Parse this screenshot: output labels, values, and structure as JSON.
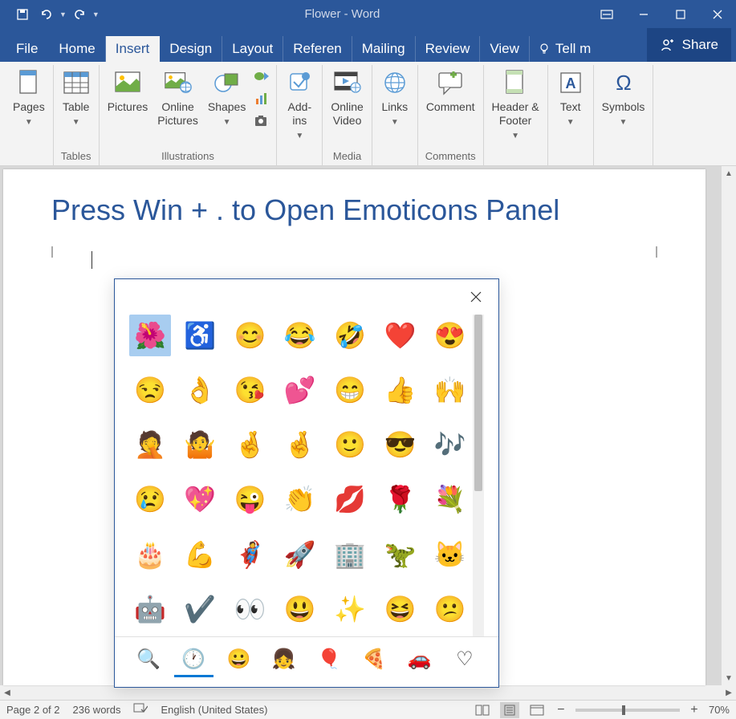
{
  "title": "Flower - Word",
  "menubar": {
    "file": "File",
    "items": [
      "Home",
      "Insert",
      "Design",
      "Layout",
      "Referen",
      "Mailing",
      "Review",
      "View"
    ],
    "active": "Insert",
    "tellme": "Tell m",
    "share": "Share"
  },
  "ribbon": {
    "groups": [
      {
        "label": "",
        "buttons": [
          {
            "label": "Pages",
            "dd": true
          }
        ]
      },
      {
        "label": "Tables",
        "buttons": [
          {
            "label": "Table",
            "dd": true
          }
        ]
      },
      {
        "label": "Illustrations",
        "buttons": [
          {
            "label": "Pictures"
          },
          {
            "label": "Online\nPictures"
          },
          {
            "label": "Shapes",
            "dd": true
          }
        ],
        "smallcol": true
      },
      {
        "label": "",
        "buttons": [
          {
            "label": "Add-\nins",
            "dd": true
          }
        ]
      },
      {
        "label": "Media",
        "buttons": [
          {
            "label": "Online\nVideo"
          }
        ]
      },
      {
        "label": "",
        "buttons": [
          {
            "label": "Links",
            "dd": true
          }
        ]
      },
      {
        "label": "Comments",
        "buttons": [
          {
            "label": "Comment"
          }
        ]
      },
      {
        "label": "",
        "buttons": [
          {
            "label": "Header &\nFooter",
            "dd": true
          }
        ]
      },
      {
        "label": "",
        "buttons": [
          {
            "label": "Text",
            "dd": true
          }
        ]
      },
      {
        "label": "",
        "buttons": [
          {
            "label": "Symbols",
            "dd": true
          }
        ]
      }
    ]
  },
  "document": {
    "heading": "Press Win + . to Open Emoticons Panel"
  },
  "emoji": {
    "grid": [
      [
        "🌺",
        "♿",
        "😊",
        "😂",
        "🤣",
        "❤️",
        "😍"
      ],
      [
        "😒",
        "👌",
        "😘",
        "💕",
        "😁",
        "👍",
        "🙌"
      ],
      [
        "🤦",
        "🤷",
        "🤞",
        "🤞",
        "🙂",
        "😎",
        "🎶"
      ],
      [
        "😢",
        "💖",
        "😜",
        "👏",
        "💋",
        "🌹",
        "💐"
      ],
      [
        "🎂",
        "💪",
        "🦸",
        "🚀",
        "🏢",
        "🦖",
        "🐱"
      ],
      [
        "🤖",
        "✔️",
        "👀",
        "😃",
        "✨",
        "😆",
        "😕"
      ]
    ],
    "selected": [
      0,
      0
    ],
    "tabs": [
      "🔍",
      "🕐",
      "😀",
      "👧",
      "🎈",
      "🍕",
      "🚗",
      "♡"
    ],
    "active_tab": 1
  },
  "statusbar": {
    "page": "Page 2 of 2",
    "words": "236 words",
    "lang": "English (United States)",
    "zoom": "70%"
  }
}
